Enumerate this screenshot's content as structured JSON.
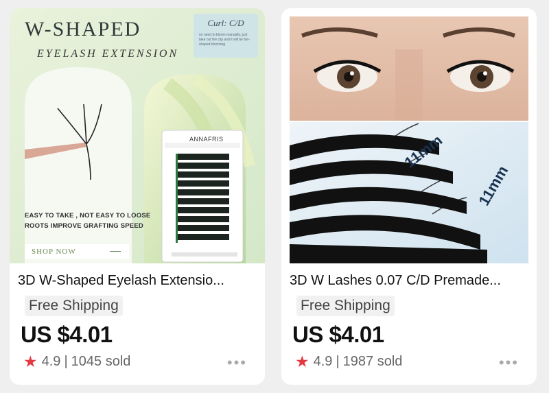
{
  "products": [
    {
      "title": "3D W-Shaped Eyelash Extensio...",
      "shipping": "Free Shipping",
      "price": "US $4.01",
      "rating": "4.9",
      "sold": "1045 sold",
      "image": {
        "headline": "W-SHAPED",
        "subheadline": "EYELASH EXTENSION",
        "curl_label": "Curl: C/D",
        "curl_note": "no need to bloom manually, just take out the clip and it will be fan-shaped blooming",
        "brand": "ANNAFRIS",
        "line1": "EASY TO TAKE , NOT EASY TO LOOSE",
        "line2": "ROOTS IMPROVE GRAFTING SPEED",
        "button": "SHOP NOW"
      }
    },
    {
      "title": "3D W Lashes 0.07 C/D Premade...",
      "shipping": "Free Shipping",
      "price": "US $4.01",
      "rating": "4.9",
      "sold": "1987 sold",
      "image": {
        "length_label": "11mm"
      }
    }
  ],
  "rating_separator": "|",
  "icons": {
    "star": "star-icon",
    "more": "more-dots-icon"
  },
  "colors": {
    "star": "#e23a45",
    "page_bg": "#efefef",
    "card_bg": "#ffffff"
  }
}
